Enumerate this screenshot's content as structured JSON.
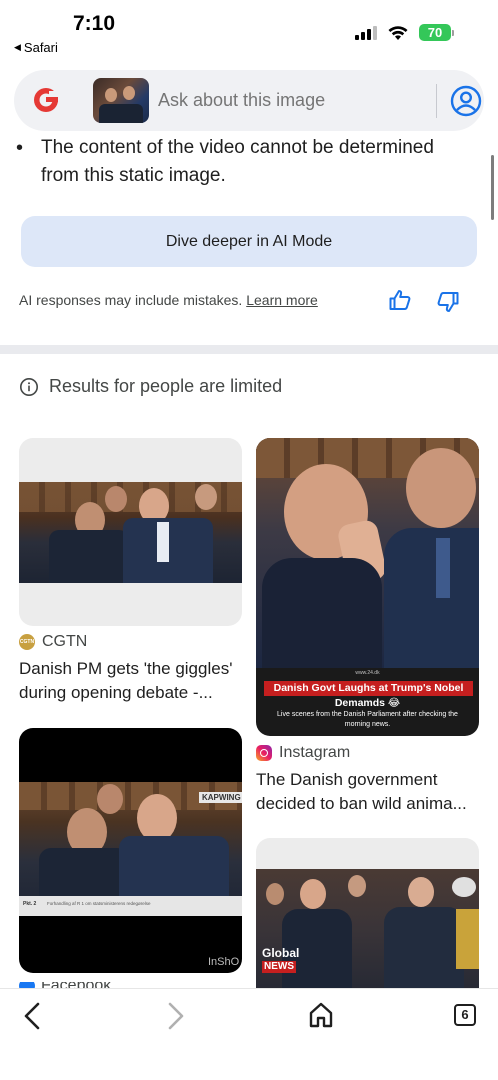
{
  "status_bar": {
    "time": "7:10",
    "back_app": "Safari",
    "battery": "70"
  },
  "search": {
    "placeholder": "Ask about this image"
  },
  "answer": {
    "bullet": "The content of the video cannot be determined from this static image.",
    "dive_deeper": "Dive deeper in AI Mode",
    "disclaimer": "AI responses may include mistakes.",
    "learn_more": "Learn more"
  },
  "results_notice": "Results for people are limited",
  "results": [
    {
      "source": "CGTN",
      "source_icon_text": "CGTN",
      "title_line1": "Danish PM gets 'the giggles'",
      "title_line2": "during opening debate -..."
    },
    {
      "source": "Instagram",
      "title_line1": "The Danish government",
      "title_line2": "decided to ban wild anima...",
      "overlay_headline": "Danish Govt Laughs at Trump's Nobel",
      "overlay_headline2": "Demamds 😂",
      "overlay_caption": "Live scenes from the Danish Parliament after checking the",
      "overlay_caption2": "morning news.",
      "overlay_small": "www.24.dk"
    },
    {
      "source": "Facebook",
      "watermark_top": "KAPWING",
      "watermark_bottom": "InShO",
      "lower_third_label": "Pkt. 2",
      "lower_third_text": "Forhandling af R 1 om statsministerens redegørelse"
    },
    {
      "logo_line1": "Global",
      "logo_line2": "NEWS"
    }
  ],
  "toolbar": {
    "tab_count": "6"
  },
  "colors": {
    "accent": "#1a73e8",
    "search_bg": "#f0f1f4",
    "dive_button_bg": "#dde7f8",
    "battery_green": "#34c759",
    "banner_red": "#c51f1f"
  },
  "icons": [
    "google-lens-g-icon",
    "account-icon",
    "thumbs-up-icon",
    "thumbs-down-icon",
    "info-icon",
    "back-arrow-icon",
    "forward-arrow-icon",
    "home-icon",
    "tabs-icon"
  ]
}
